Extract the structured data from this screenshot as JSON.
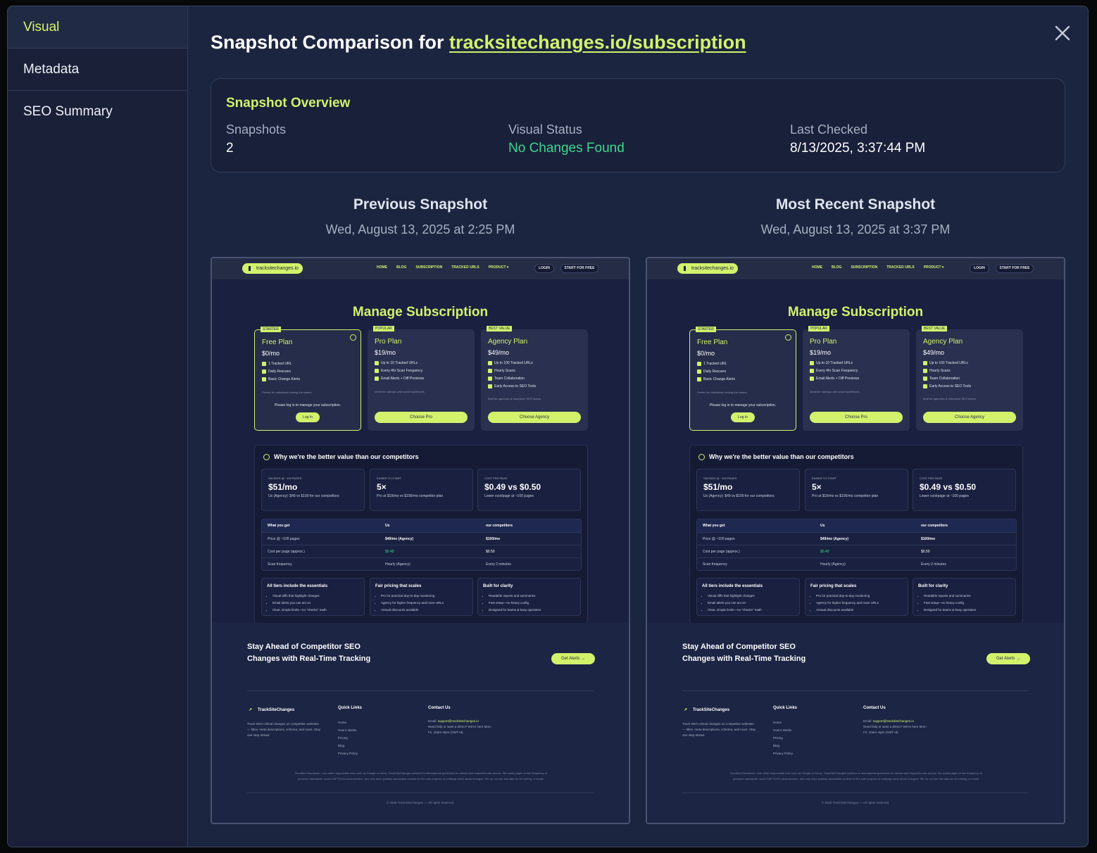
{
  "sidebar": {
    "items": [
      "Visual",
      "Metadata",
      "SEO Summary"
    ]
  },
  "header": {
    "prefix": "Snapshot Comparison for",
    "url": "tracksitechanges.io/subscription"
  },
  "overview": {
    "title": "Snapshot Overview",
    "snapshots_label": "Snapshots",
    "snapshots_value": "2",
    "status_label": "Visual Status",
    "status_value": "No Changes Found",
    "checked_label": "Last Checked",
    "checked_value": "8/13/2025, 3:37:44 PM"
  },
  "snapshots": [
    {
      "title": "Previous Snapshot",
      "date": "Wed, August 13, 2025 at 2:25 PM"
    },
    {
      "title": "Most Recent Snapshot",
      "date": "Wed, August 13, 2025 at 3:37 PM"
    }
  ],
  "page": {
    "logo": "tracksitechanges.io",
    "nav": [
      "HOME",
      "BLOG",
      "SUBSCRIPTION",
      "TRACKED URLS",
      "PRODUCT ▾"
    ],
    "login": "LOGIN",
    "start": "START FOR FREE",
    "hero": "Manage Subscription",
    "plans": [
      {
        "badge": "STARTER",
        "name": "Free Plan",
        "price": "$0/mo",
        "features": [
          "1 Tracked URL",
          "Daily Rescans",
          "Basic Change Alerts"
        ],
        "note": "Perfect for individuals testing the waters.",
        "login_note": "Please log in to manage your subscription.",
        "cta": "Log In"
      },
      {
        "badge": "POPULAR",
        "name": "Pro Plan",
        "price": "$19/mo",
        "features": [
          "Up to 10 Tracked URLs",
          "Every 4hr Scan Frequency",
          "Email Alerts + Diff Previews"
        ],
        "note": "Great for startups and small businesses.",
        "cta": "Choose Pro"
      },
      {
        "badge": "BEST VALUE",
        "name": "Agency Plan",
        "price": "$49/mo",
        "features": [
          "Up to 100 Tracked URLs",
          "Hourly Scans",
          "Team Collaboration",
          "Early Access to SEO Tools"
        ],
        "note": "Built for agencies & enterprise SEO teams.",
        "cta": "Choose Agency"
      }
    ],
    "value_title": "Why we're the better value than our competitors",
    "stats": [
      {
        "k": "SAVINGS @ ~100 PAGES",
        "v": "$51/mo",
        "d": "Us (Agency): $49 vs $100 for our competitors"
      },
      {
        "k": "EASIER TO START",
        "v": "5×",
        "d": "Pro at $19/mo vs $100/mo competitor plan"
      },
      {
        "k": "COST PER PAGE",
        "v": "$0.49 vs $0.50",
        "d": "Lower cost/page at ~100 pages"
      }
    ],
    "table": {
      "head": [
        "What you get",
        "Us",
        "our competitors"
      ],
      "rows": [
        [
          "Price @ ~100 pages",
          "$49/mo (Agency)",
          "$100/mo"
        ],
        [
          "Cost per page (approx.)",
          "$0.49",
          "$0.50"
        ],
        [
          "Scan frequency",
          "Hourly (Agency)",
          "Every 2 minutes"
        ]
      ]
    },
    "boxes": [
      {
        "t": "All tiers include the essentials",
        "items": [
          "Visual diffs that highlight changes",
          "Email alerts you can act on",
          "Clear, simple limits—no \"checks\" math"
        ]
      },
      {
        "t": "Fair pricing that scales",
        "items": [
          "Pro for practical day-to-day monitoring",
          "Agency for higher frequency and more URLs",
          "Annual discounts available"
        ]
      },
      {
        "t": "Built for clarity",
        "items": [
          "Readable reports and summaries",
          "Fast setup—no heavy config",
          "Designed for teams & busy operators"
        ]
      }
    ],
    "cta_text": "Stay Ahead of Competitor SEO Changes with Real-Time Tracking",
    "cta_btn": "Get Alerts →",
    "footer": {
      "brand": "TrackSiteChanges",
      "desc": "Track SEO-critical changes on competitor websites — titles, meta descriptions, schema, and more. Stay one step ahead.",
      "quick_title": "Quick Links",
      "quick": [
        "Home",
        "How it Works",
        "Pricing",
        "Blog",
        "Privacy Policy"
      ],
      "contact_title": "Contact Us",
      "email_label": "Email:",
      "email": "support@tracksitechanges.io",
      "help": "Need help or want a demo? We're here Mon–Fri, 10am–6pm (GMT+8)",
      "disclaimer": "GoodBot Disclaimer: Like other responsible bots such as Google or Alexa, TrackSiteChanges adheres to international guidelines for ethical and respectful site access. We crawl pages at low frequency to preserve bandwidth, avoid CAPTCHA circumvention, and only store publicly accessible content for the sole purpose of notifying users about changes. We do not use this data for AI training or resale.",
      "copyright": "© 2025 TrackSiteChanges — All rights reserved."
    }
  }
}
